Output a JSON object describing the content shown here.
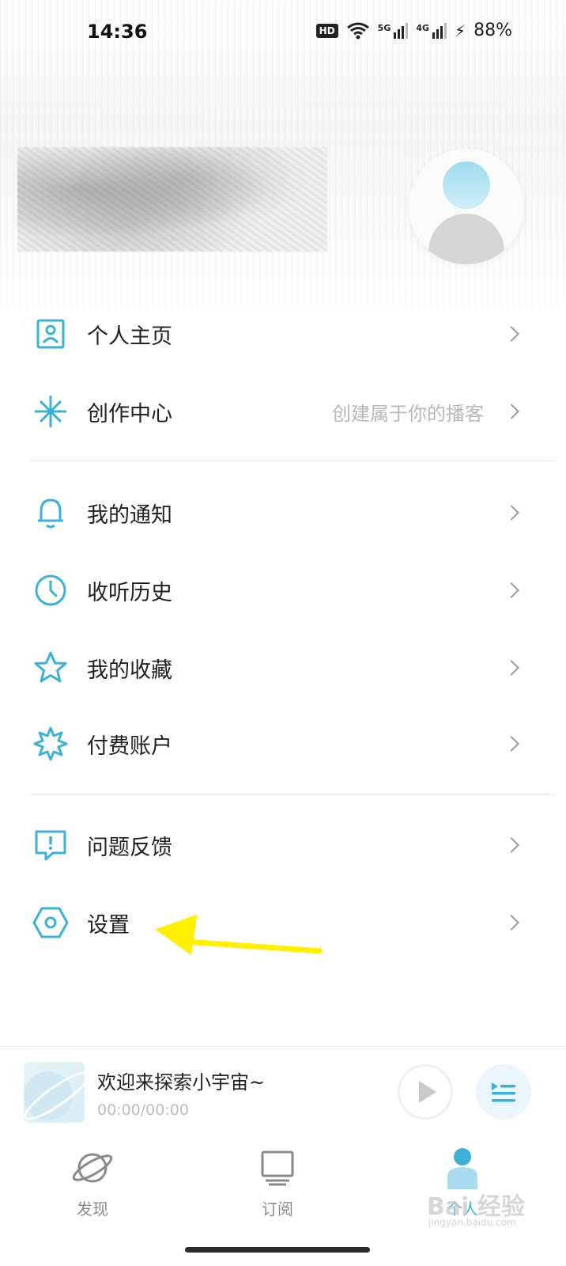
{
  "status_bar": {
    "time": "14:36",
    "hd_badge": "HD",
    "signal_5g": "5G",
    "signal_4g": "4G",
    "battery": "88%",
    "charging_icon": "bolt-icon"
  },
  "menu": {
    "group1": [
      {
        "label": "个人主页",
        "hint": "",
        "icon": "profile-card-icon"
      },
      {
        "label": "创作中心",
        "hint": "创建属于你的播客",
        "icon": "sparkle-icon"
      }
    ],
    "group2": [
      {
        "label": "我的通知",
        "icon": "bell-icon"
      },
      {
        "label": "收听历史",
        "icon": "clock-icon"
      },
      {
        "label": "我的收藏",
        "icon": "star-icon"
      },
      {
        "label": "付费账户",
        "icon": "badge-icon"
      }
    ],
    "group3": [
      {
        "label": "问题反馈",
        "icon": "feedback-icon"
      },
      {
        "label": "设置",
        "icon": "settings-icon"
      }
    ]
  },
  "player": {
    "title": "欢迎来探索小宇宙~",
    "time": "00:00/00:00"
  },
  "tabs": [
    {
      "label": "发现",
      "icon": "planet-icon",
      "active": false
    },
    {
      "label": "订阅",
      "icon": "screen-icon",
      "active": false
    },
    {
      "label": "个人",
      "icon": "person-icon",
      "active": true
    }
  ],
  "watermark": {
    "main": "Bai 经验",
    "sub": "jingyan.baidu.com"
  },
  "colors": {
    "accent": "#3bb1d9",
    "annotation": "#ffef00"
  }
}
